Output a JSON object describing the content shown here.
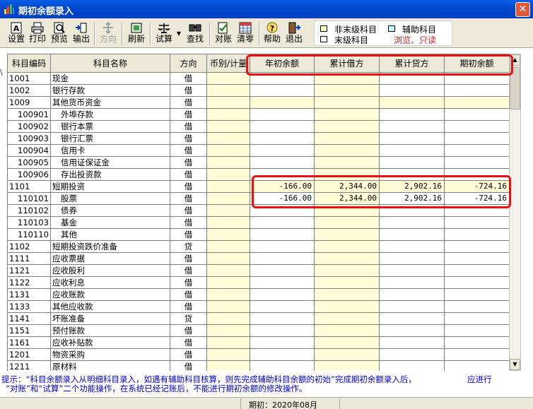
{
  "window": {
    "title": "期初余额录入"
  },
  "toolbar": {
    "buttons": [
      {
        "label": "设置"
      },
      {
        "label": "打印"
      },
      {
        "label": "预览"
      },
      {
        "label": "输出"
      },
      {
        "label": "方向"
      },
      {
        "label": "刷新"
      },
      {
        "label": "试算"
      },
      {
        "label": "查找"
      },
      {
        "label": "对账"
      },
      {
        "label": "清零"
      },
      {
        "label": "帮助"
      },
      {
        "label": "退出"
      }
    ]
  },
  "legend": {
    "non_leaf": "非末级科目",
    "leaf": "末级科目",
    "auxiliary": "辅助科目",
    "readonly": "浏览、只读",
    "colors": {
      "non_leaf": "#ffffc0",
      "leaf": "#ffffff",
      "auxiliary": "#c0ffff",
      "readonly": "#d02020"
    }
  },
  "grid": {
    "headers": [
      "科目编码",
      "科目名称",
      "方向",
      "币别/计量",
      "年初余额",
      "累计借方",
      "累计贷方",
      "期初余额"
    ],
    "rows": [
      {
        "code": "1001",
        "name": "现金",
        "dir": "借",
        "indent": false,
        "a": "",
        "b": "",
        "c": "",
        "d": ""
      },
      {
        "code": "1002",
        "name": "银行存款",
        "dir": "借",
        "indent": false,
        "a": "",
        "b": "",
        "c": "",
        "d": ""
      },
      {
        "code": "1009",
        "name": "其他货币资金",
        "dir": "借",
        "indent": false,
        "a": "",
        "b": "",
        "c": "",
        "d": ""
      },
      {
        "code": "100901",
        "name": "外埠存款",
        "dir": "借",
        "indent": true,
        "a": "",
        "b": "",
        "c": "",
        "d": ""
      },
      {
        "code": "100902",
        "name": "银行本票",
        "dir": "借",
        "indent": true,
        "a": "",
        "b": "",
        "c": "",
        "d": ""
      },
      {
        "code": "100903",
        "name": "银行汇票",
        "dir": "借",
        "indent": true,
        "a": "",
        "b": "",
        "c": "",
        "d": ""
      },
      {
        "code": "100904",
        "name": "信用卡",
        "dir": "借",
        "indent": true,
        "a": "",
        "b": "",
        "c": "",
        "d": ""
      },
      {
        "code": "100905",
        "name": "信用证保证金",
        "dir": "借",
        "indent": true,
        "a": "",
        "b": "",
        "c": "",
        "d": ""
      },
      {
        "code": "100906",
        "name": "存出投资款",
        "dir": "借",
        "indent": true,
        "a": "",
        "b": "",
        "c": "",
        "d": ""
      },
      {
        "code": "1101",
        "name": "短期投资",
        "dir": "借",
        "indent": false,
        "a": "-166.00",
        "b": "2,344.00",
        "c": "2,902.16",
        "d": "-724.16"
      },
      {
        "code": "110101",
        "name": "股票",
        "dir": "借",
        "indent": true,
        "a": "-166.00",
        "b": "2,344.00",
        "c": "2,902.16",
        "d": "-724.16"
      },
      {
        "code": "110102",
        "name": "债券",
        "dir": "借",
        "indent": true,
        "a": "",
        "b": "",
        "c": "",
        "d": ""
      },
      {
        "code": "110103",
        "name": "基金",
        "dir": "借",
        "indent": true,
        "a": "",
        "b": "",
        "c": "",
        "d": ""
      },
      {
        "code": "110110",
        "name": "其他",
        "dir": "借",
        "indent": true,
        "a": "",
        "b": "",
        "c": "",
        "d": ""
      },
      {
        "code": "1102",
        "name": "短期投资跌价准备",
        "dir": "贷",
        "indent": false,
        "a": "",
        "b": "",
        "c": "",
        "d": ""
      },
      {
        "code": "1111",
        "name": "应收票据",
        "dir": "借",
        "indent": false,
        "a": "",
        "b": "",
        "c": "",
        "d": ""
      },
      {
        "code": "1121",
        "name": "应收股利",
        "dir": "借",
        "indent": false,
        "a": "",
        "b": "",
        "c": "",
        "d": ""
      },
      {
        "code": "1122",
        "name": "应收利息",
        "dir": "借",
        "indent": false,
        "a": "",
        "b": "",
        "c": "",
        "d": ""
      },
      {
        "code": "1131",
        "name": "应收账款",
        "dir": "借",
        "indent": false,
        "a": "",
        "b": "",
        "c": "",
        "d": ""
      },
      {
        "code": "1133",
        "name": "其他应收款",
        "dir": "借",
        "indent": false,
        "a": "",
        "b": "",
        "c": "",
        "d": ""
      },
      {
        "code": "1141",
        "name": "坏账准备",
        "dir": "贷",
        "indent": false,
        "a": "",
        "b": "",
        "c": "",
        "d": ""
      },
      {
        "code": "1151",
        "name": "预付账款",
        "dir": "借",
        "indent": false,
        "a": "",
        "b": "",
        "c": "",
        "d": ""
      },
      {
        "code": "1161",
        "name": "应收补贴款",
        "dir": "借",
        "indent": false,
        "a": "",
        "b": "",
        "c": "",
        "d": ""
      },
      {
        "code": "1201",
        "name": "物资采购",
        "dir": "借",
        "indent": false,
        "a": "",
        "b": "",
        "c": "",
        "d": ""
      },
      {
        "code": "1211",
        "name": "原材料",
        "dir": "借",
        "indent": false,
        "a": "",
        "b": "",
        "c": "",
        "d": ""
      }
    ]
  },
  "hint": {
    "line1": "提示：“科目余额录入从明细科目录入，如遇有辅助科目核算，则先完成辅助科目余额的初始”完成期初余额录入后，",
    "line1_tail": "应进行",
    "line2": "“对账”和“试算”二个功能操作，在系统已经记账后，不能进行期初余额的修改操作。"
  },
  "status": {
    "period": "期初：2020年08月"
  }
}
